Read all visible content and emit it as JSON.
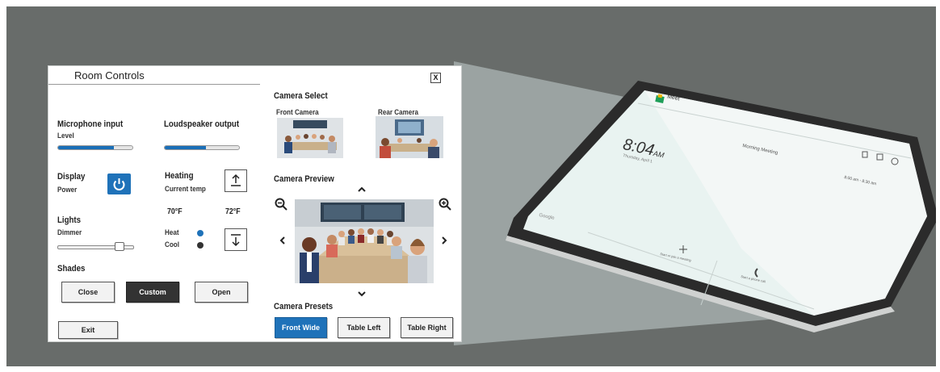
{
  "panel": {
    "title": "Room Controls",
    "close_label": "X",
    "microphone": {
      "label": "Microphone input",
      "sub": "Level",
      "level": 0.75
    },
    "loudspeaker": {
      "label": "Loudspeaker output",
      "level": 0.55
    },
    "display": {
      "label": "Display",
      "sub": "Power"
    },
    "heating": {
      "label": "Heating",
      "sub": "Current temp",
      "temp_left": "70°F",
      "temp_right": "72°F",
      "heat_label": "Heat",
      "cool_label": "Cool",
      "heat_color": "#1f72b9",
      "cool_color": "#333333"
    },
    "lights": {
      "label": "Lights",
      "sub": "Dimmer",
      "level": 0.85
    },
    "shades": {
      "label": "Shades",
      "buttons": [
        "Close",
        "Custom",
        "Open"
      ]
    },
    "exit_label": "Exit",
    "camera_select": {
      "label": "Camera Select",
      "front": "Front Camera",
      "rear": "Rear Camera"
    },
    "camera_preview": {
      "label": "Camera Preview"
    },
    "camera_presets": {
      "label": "Camera Presets",
      "buttons": [
        "Front Wide",
        "Table Left",
        "Table Right"
      ]
    }
  },
  "tablet": {
    "app_name": "Meet",
    "time": "8:04",
    "ampm": "AM",
    "date": "Thursday, April 1",
    "meeting_title": "Morning Meeting",
    "meeting_time": "8:00 am - 8:30 am",
    "room": "Google",
    "tile_left": "Start or join a meeting",
    "tile_right": "Start a phone call"
  },
  "colors": {
    "accent": "#1f72b9",
    "background": "#686c6a",
    "screen": "#e9f3f1"
  }
}
